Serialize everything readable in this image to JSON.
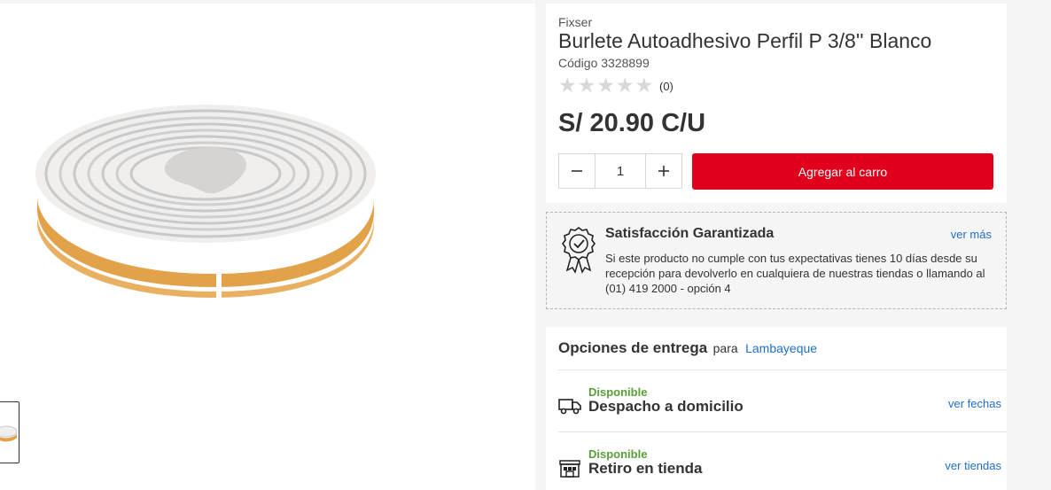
{
  "product": {
    "brand": "Fixser",
    "title": "Burlete Autoadhesivo Perfil P 3/8'' Blanco",
    "code": "Código 3328899",
    "reviews": "(0)",
    "price": "S/ 20.90 C/U",
    "quantity": "1",
    "add_to_cart": "Agregar al carro"
  },
  "guarantee": {
    "title": "Satisfacción Garantizada",
    "more": "ver más",
    "description": "Si este producto no cumple con tus expectativas tienes 10 días desde su recepción para devolverlo en cualquiera de nuestras tiendas o llamando al (01) 419 2000 - opción 4"
  },
  "delivery": {
    "title": "Opciones de entrega",
    "para": "para",
    "location": "Lambayeque",
    "options": [
      {
        "status": "Disponible",
        "name": "Despacho a domicilio",
        "link": "ver fechas",
        "icon": "truck-icon"
      },
      {
        "status": "Disponible",
        "name": "Retiro en tienda",
        "link": "ver tiendas",
        "icon": "store-icon"
      }
    ]
  },
  "colors": {
    "accent": "#e0001b",
    "link": "#1e6fc4",
    "available": "#5a9e3a"
  }
}
